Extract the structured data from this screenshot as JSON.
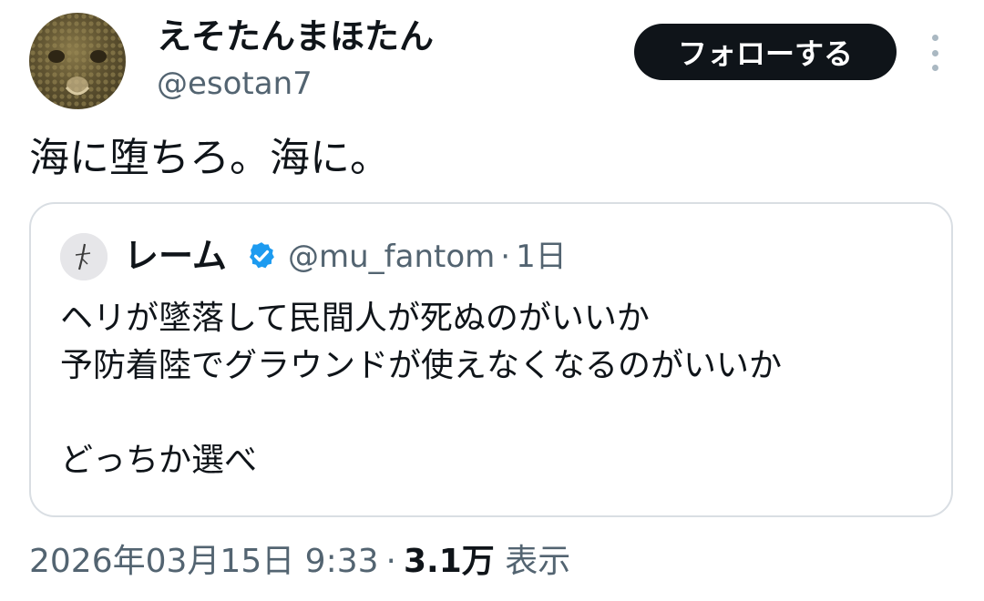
{
  "author": {
    "display_name": "えそたんまほたん",
    "handle": "@esotan7",
    "avatar_icon": "fish-face-avatar"
  },
  "actions": {
    "follow_label": "フォローする",
    "more_icon": "vertical-ellipsis-icon"
  },
  "tweet": {
    "text": "海に堕ちろ。海に。"
  },
  "quoted_tweet": {
    "display_name": "レーム",
    "verified": true,
    "verified_color": "#1d9bf0",
    "handle": "@mu_fantom",
    "separator": "·",
    "time": "1日",
    "lines": [
      "ヘリが墜落して民間人が死ぬのがいいか",
      "予防着陸でグラウンドが使えなくなるのがいいか",
      "",
      "どっちか選べ"
    ]
  },
  "footer": {
    "timestamp": "2026年03月15日 9:33",
    "separator": "·",
    "view_count": "3.1万",
    "view_label": "表示"
  },
  "colors": {
    "text_primary": "#0f1419",
    "text_secondary": "#536471",
    "follow_button_bg": "#0f1419",
    "border": "#d9dee3"
  }
}
